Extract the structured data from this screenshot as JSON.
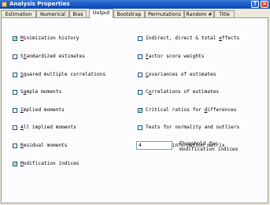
{
  "window": {
    "title": "Analysis Properties",
    "help_label": "?",
    "close_label": "×"
  },
  "tabs": [
    {
      "label": "Estimation"
    },
    {
      "label": "Numerical"
    },
    {
      "label": "Bias"
    },
    {
      "label": "Output",
      "active": true
    },
    {
      "label": "Bootstrap"
    },
    {
      "label": "Permutations"
    },
    {
      "label": "Random #"
    },
    {
      "label": "Title"
    }
  ],
  "left_options": [
    {
      "pre": "",
      "ul": "M",
      "post": "inimization history",
      "checked": true
    },
    {
      "pre": "S",
      "ul": "t",
      "post": "andardized estimates",
      "checked": false
    },
    {
      "pre": "",
      "ul": "S",
      "post": "quared multiple correlations",
      "checked": false
    },
    {
      "pre": "S",
      "ul": "a",
      "post": "mple moments",
      "checked": false
    },
    {
      "pre": "",
      "ul": "I",
      "post": "mplied moments",
      "checked": false
    },
    {
      "pre": "",
      "ul": "A",
      "post": "ll implied moments",
      "checked": false
    },
    {
      "pre": "",
      "ul": "R",
      "post": "esidual moments",
      "checked": false
    },
    {
      "pre": "",
      "ul": "M",
      "post": "odification indices",
      "checked": true
    }
  ],
  "right_options": [
    {
      "pre": "Indirect, direct & total ",
      "ul": "e",
      "post": "ffects",
      "checked": false
    },
    {
      "pre": "",
      "ul": "F",
      "post": "actor score weights",
      "checked": false
    },
    {
      "pre": "",
      "ul": "C",
      "post": "ovariances of estimates",
      "checked": false
    },
    {
      "pre": "C",
      "ul": "o",
      "post": "rrelations of estimates",
      "checked": false
    },
    {
      "pre": "Critical ratios for ",
      "ul": "d",
      "post": "ifferences",
      "checked": true
    },
    {
      "pre": "Tests for normality and outliers",
      "ul": "",
      "post": "",
      "checked": false
    },
    {
      "pre": "O",
      "ul": "b",
      "post": "served information matrix",
      "checked": false
    }
  ],
  "threshold": {
    "value": "4",
    "label": "Threshold for modification indices"
  }
}
